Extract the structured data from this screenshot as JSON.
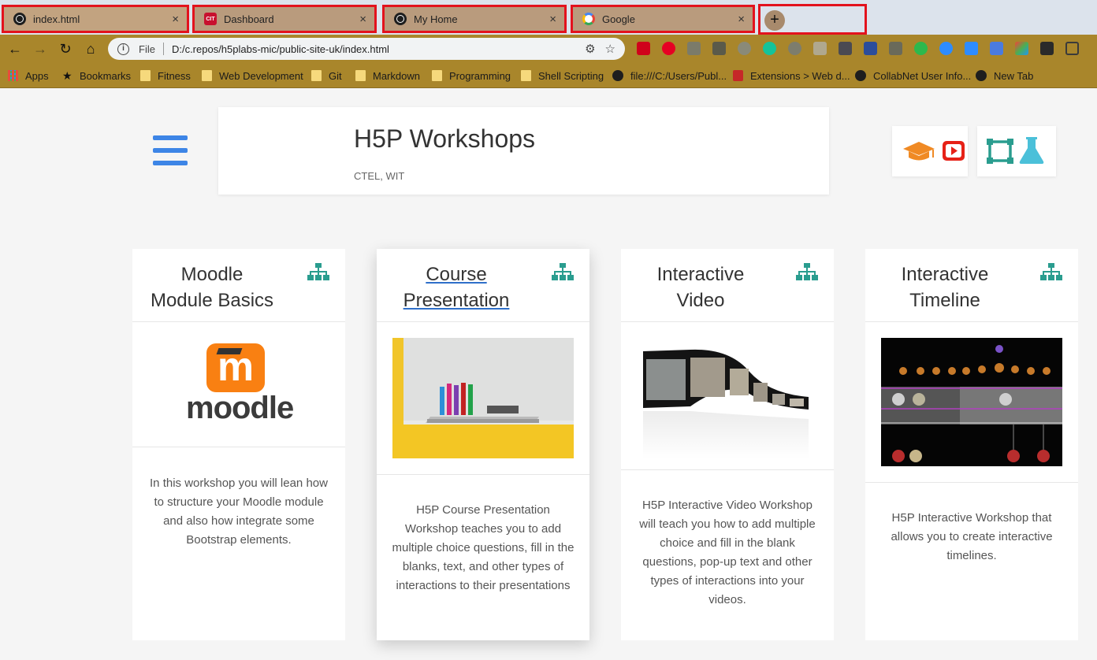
{
  "tabs": [
    {
      "label": "index.html",
      "icon": "globe-icon"
    },
    {
      "label": "Dashboard",
      "icon": "cit-icon",
      "icon_text": "CIT"
    },
    {
      "label": "My Home",
      "icon": "globe-icon"
    },
    {
      "label": "Google",
      "icon": "google-icon"
    }
  ],
  "tab_close_glyph": "×",
  "new_tab_glyph": "+",
  "omnibox": {
    "scheme": "File",
    "url": "D:/c.repos/h5plabs-mic/public-site-uk/index.html"
  },
  "bookmarks": [
    {
      "label": "Apps"
    },
    {
      "label": "Bookmarks"
    },
    {
      "label": "Fitness"
    },
    {
      "label": "Web Development"
    },
    {
      "label": "Git"
    },
    {
      "label": "Markdown"
    },
    {
      "label": "Programming"
    },
    {
      "label": "Shell Scripting"
    },
    {
      "label": "file:///C:/Users/Publ..."
    },
    {
      "label": "Extensions > Web d..."
    },
    {
      "label": "CollabNet User Info..."
    },
    {
      "label": "New Tab"
    }
  ],
  "page": {
    "title": "H5P Workshops",
    "subtitle": "CTEL, WIT"
  },
  "cards": [
    {
      "title_line1": "Moodle",
      "title_line2": "Module Basics",
      "desc": "In this workshop you will lean how to structure your Moodle module and also how integrate some Bootstrap elements.",
      "logo_word": "moodle",
      "logo_letter": "m"
    },
    {
      "title_line1": "Course",
      "title_line2": "Presentation",
      "desc": "H5P Course Presentation Workshop teaches you to add multiple choice questions, fill in the blanks, text, and other types of interactions to their presentations"
    },
    {
      "title_line1": "Interactive",
      "title_line2": "Video",
      "desc": "H5P Interactive Video Workshop will teach you how to add multiple choice and fill in the blank questions, pop-up text and other types of interactions into your videos."
    },
    {
      "title_line1": "Interactive",
      "title_line2": "Timeline",
      "desc": "H5P Interactive Workshop that allows you to create interactive timelines."
    }
  ],
  "colors": {
    "accent_blue": "#3d85e6",
    "teal": "#2a9d8f",
    "youtube_red": "#e62117",
    "cap_orange": "#f08a24",
    "flask_cyan": "#4bc0d9",
    "moodle_orange": "#f98012"
  }
}
